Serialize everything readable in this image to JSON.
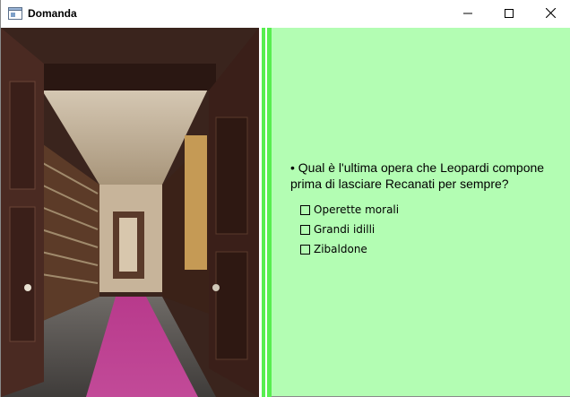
{
  "window": {
    "title": "Domanda"
  },
  "colors": {
    "panel_bg": "#b3fdb3",
    "divider": "#58ee50"
  },
  "image": {
    "description_icon": "photo-of-library-corridor"
  },
  "question": {
    "text": "• Qual è l'ultima opera che Leopardi compone prima di lasciare Recanati per sempre?",
    "options": [
      {
        "label": "Operette morali",
        "checked": false
      },
      {
        "label": "Grandi idilli",
        "checked": false
      },
      {
        "label": "Zibaldone",
        "checked": false
      }
    ]
  }
}
